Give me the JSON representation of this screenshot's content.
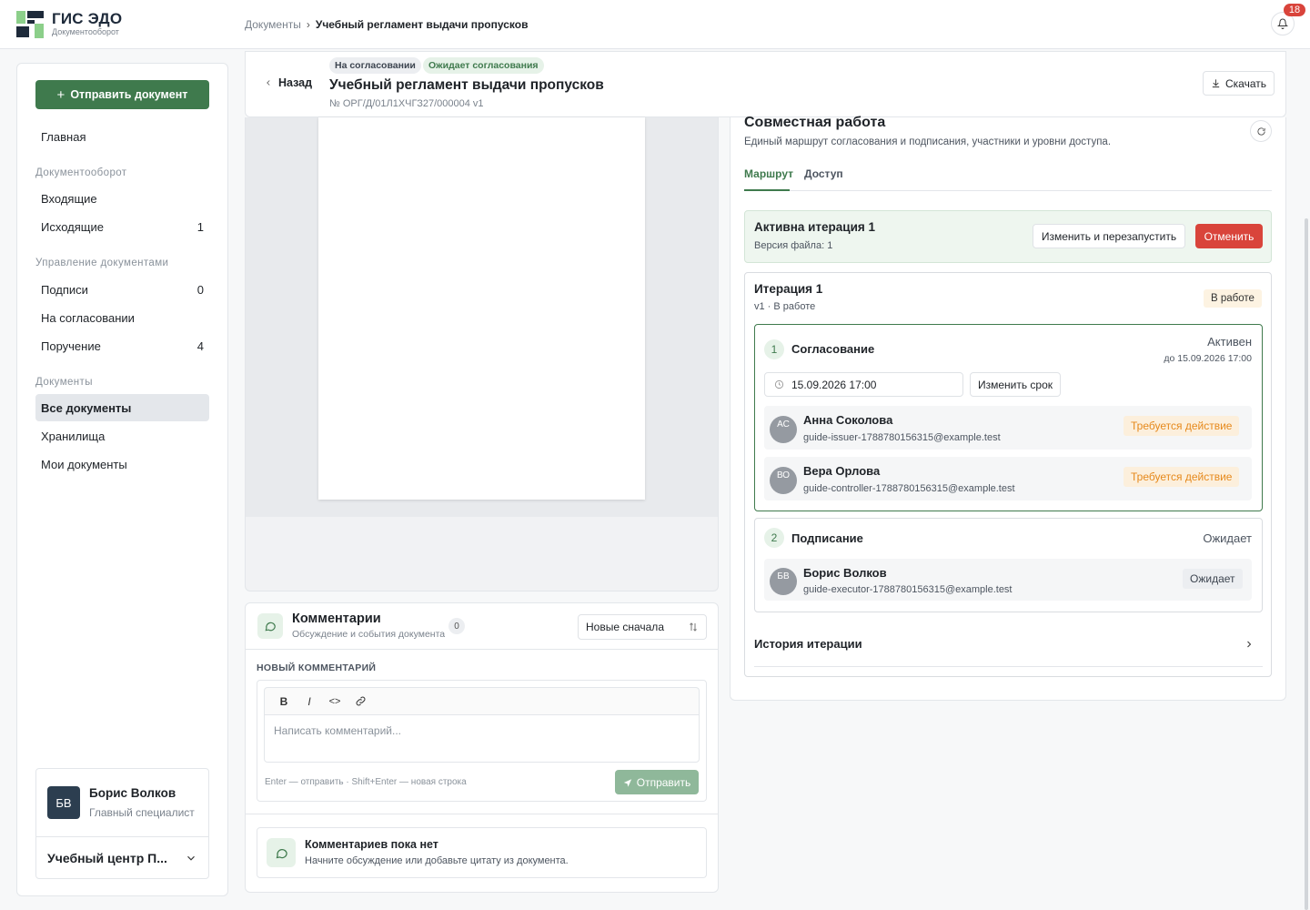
{
  "app": {
    "title": "ГИС ЭДО",
    "subtitle": "Документооборот"
  },
  "breadcrumb": {
    "root": "Документы",
    "separator": "›",
    "current": "Учебный регламент выдачи пропусков"
  },
  "notifications": {
    "count": "18"
  },
  "sidebar": {
    "send_button": "Отправить документ",
    "home": "Главная",
    "sections": [
      {
        "title": "Документооборот",
        "items": [
          {
            "label": "Входящие",
            "count": ""
          },
          {
            "label": "Исходящие",
            "count": "1"
          }
        ]
      },
      {
        "title": "Управление документами",
        "items": [
          {
            "label": "Подписи",
            "count": "0"
          },
          {
            "label": "На согласовании",
            "count": ""
          },
          {
            "label": "Поручение",
            "count": "4"
          }
        ]
      },
      {
        "title": "Документы",
        "items": [
          {
            "label": "Все документы",
            "count": ""
          },
          {
            "label": "Хранилища",
            "count": ""
          },
          {
            "label": "Мои документы",
            "count": ""
          }
        ]
      }
    ],
    "user": {
      "initials": "БВ",
      "name": "Борис Волков",
      "role": "Главный специалист",
      "org": "Учебный центр П..."
    }
  },
  "doc": {
    "back": "Назад",
    "badges": [
      "На согласовании",
      "Ожидает согласования"
    ],
    "title": "Учебный регламент выдачи пропусков",
    "number": "№ ОРГ/Д/01Л1ХЧГЗ27/000004  v1",
    "download": "Скачать"
  },
  "comments": {
    "title": "Комментарии",
    "subtitle": "Обсуждение и события документа",
    "count": "0",
    "sort": "Новые сначала",
    "new_label": "НОВЫЙ КОММЕНТАРИЙ",
    "toolbar": [
      "B",
      "I",
      "<>",
      "link"
    ],
    "placeholder": "Написать комментарий...",
    "hint": "Enter — отправить · Shift+Enter — новая строка",
    "send": "Отправить",
    "empty_title": "Комментариев пока нет",
    "empty_sub": "Начните обсуждение или добавьте цитату из документа."
  },
  "collab": {
    "title": "Совместная работа",
    "subtitle": "Единый маршрут согласования и подписания, участники и уровни доступа.",
    "tabs": [
      "Маршрут",
      "Доступ"
    ],
    "active_iteration": {
      "title": "Активна итерация 1",
      "sub": "Версия файла: 1",
      "restart": "Изменить и перезапустить",
      "cancel": "Отменить"
    },
    "iteration": {
      "title": "Итерация 1",
      "sub": "v1 · В работе",
      "status": "В работе"
    },
    "stages": [
      {
        "num": "1",
        "title": "Согласование",
        "state": "Активен",
        "deadline": "до 15.09.2026 17:00",
        "date_value": "15.09.2026 17:00",
        "change_deadline": "Изменить срок",
        "people": [
          {
            "initials": "АС",
            "name": "Анна Соколова",
            "email": "guide-issuer-1788780156315@example.test",
            "tag": "Требуется действие"
          },
          {
            "initials": "ВО",
            "name": "Вера Орлова",
            "email": "guide-controller-1788780156315@example.test",
            "tag": "Требуется действие"
          }
        ]
      },
      {
        "num": "2",
        "title": "Подписание",
        "state": "Ожидает",
        "people": [
          {
            "initials": "БВ",
            "name": "Борис Волков",
            "email": "guide-executor-1788780156315@example.test",
            "tag": "Ожидает"
          }
        ]
      }
    ],
    "history": "История итерации"
  },
  "colors": {
    "accent": "#3f7a4d",
    "danger": "#d9443b",
    "warn": "#e6891c"
  }
}
